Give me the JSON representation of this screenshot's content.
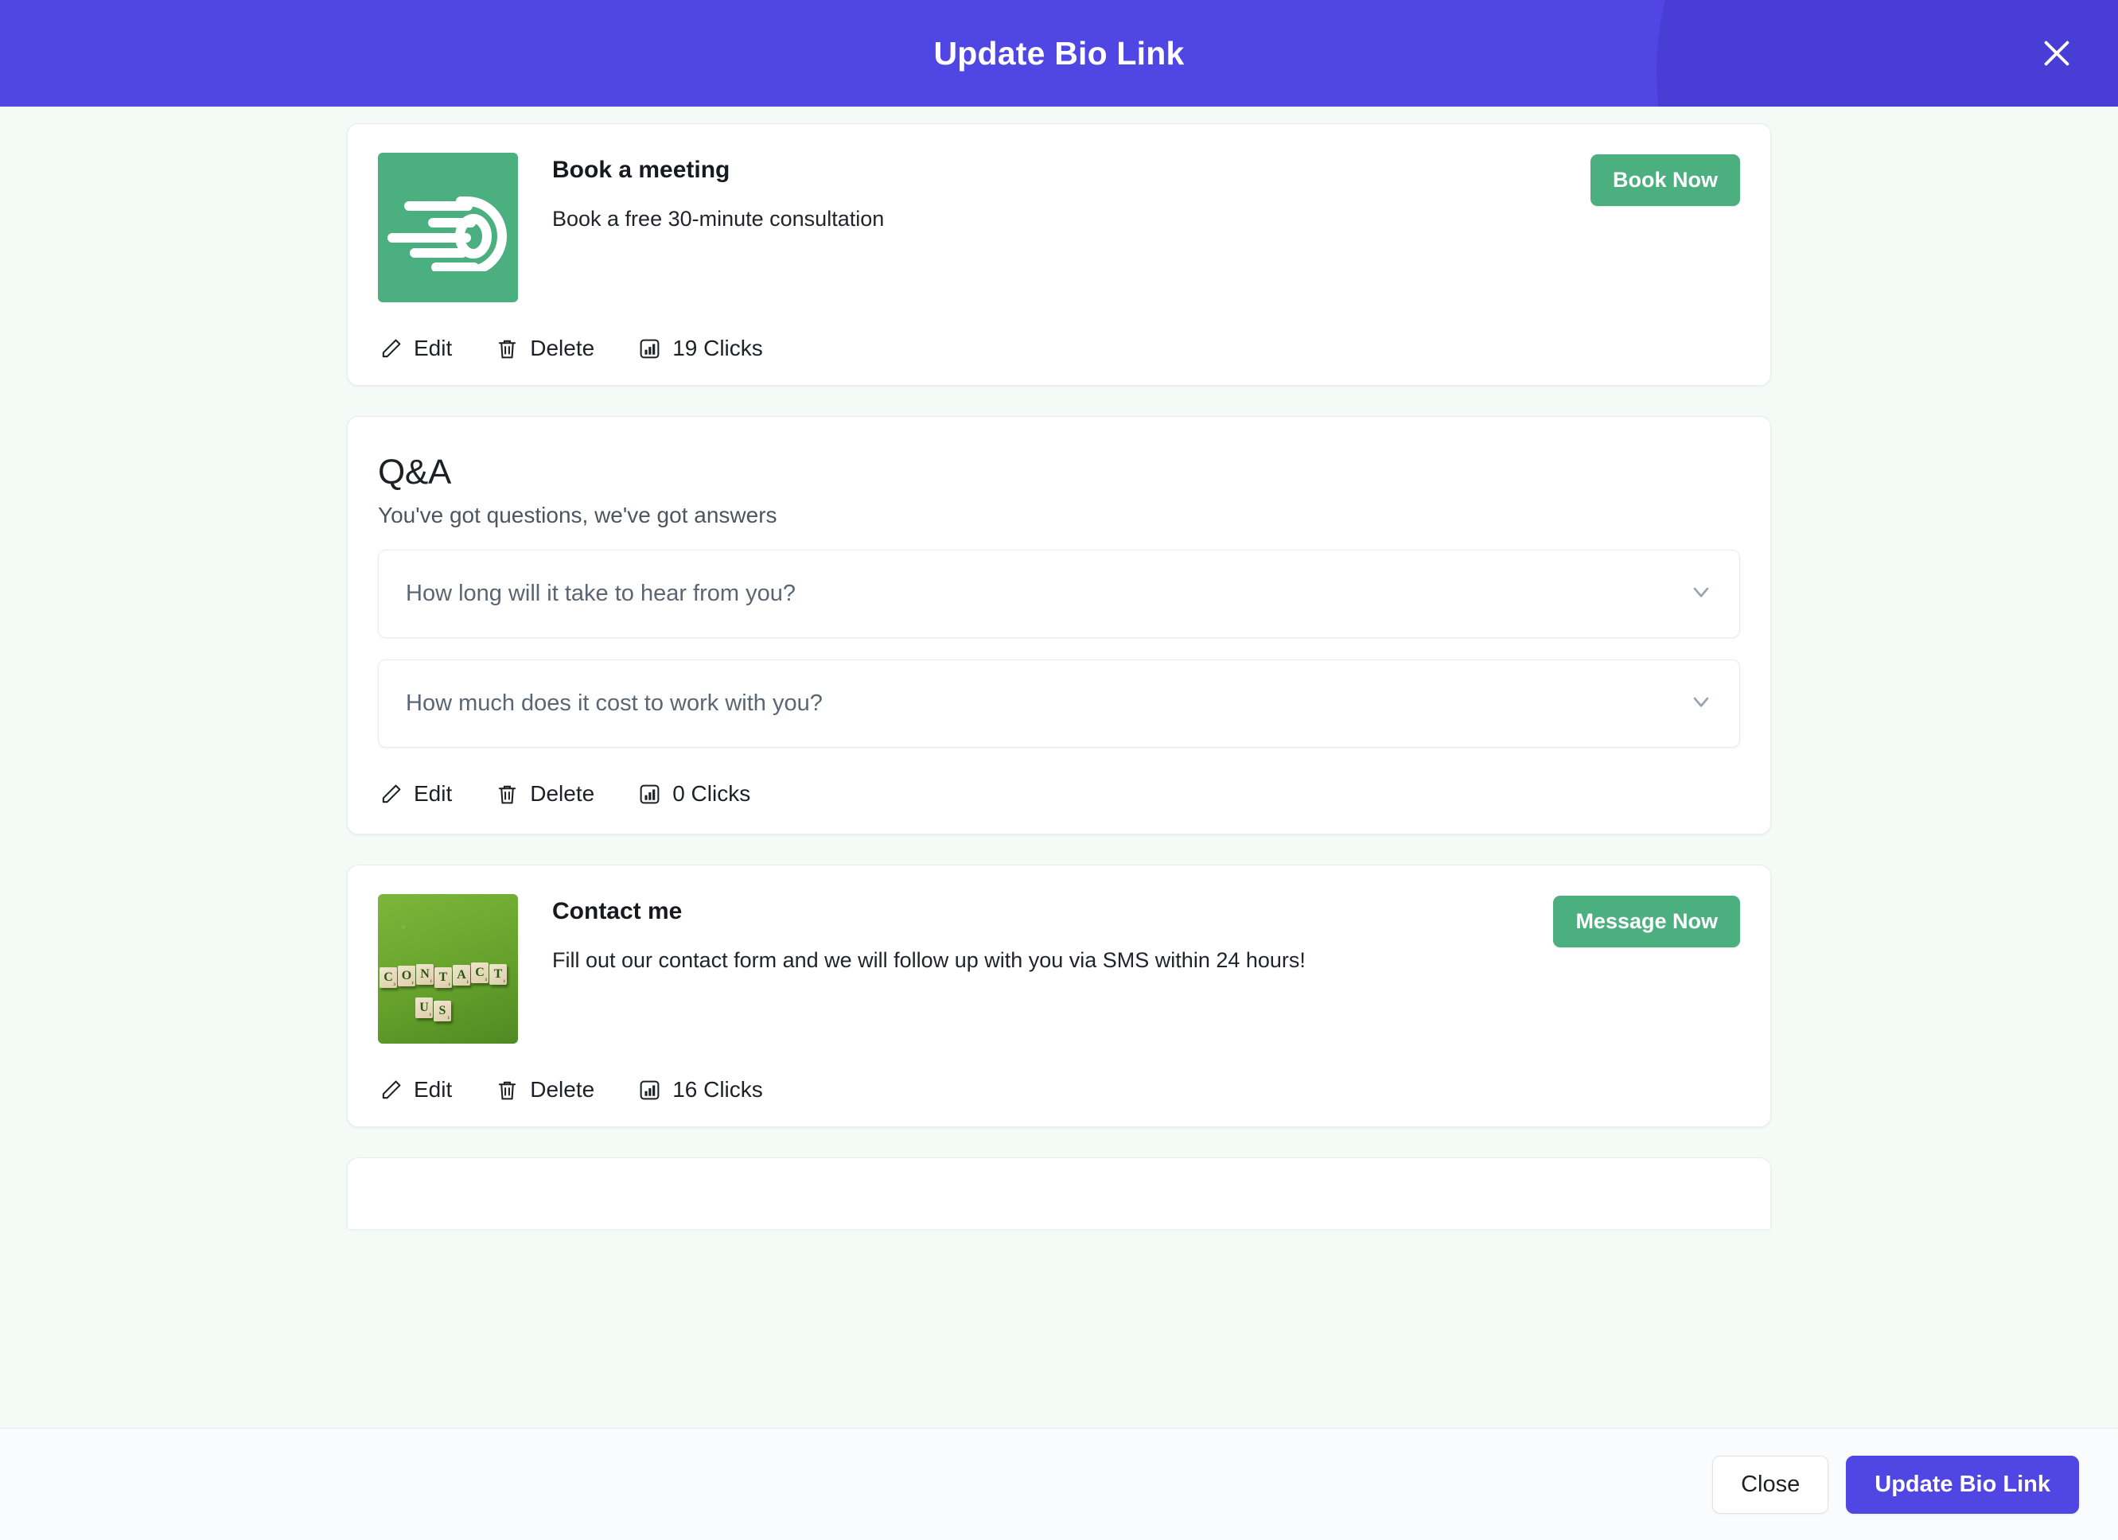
{
  "header": {
    "title": "Update Bio Link",
    "close_icon": "close-icon"
  },
  "colors": {
    "accent_purple": "#5046e4",
    "accent_purple_dark": "#4338ca",
    "green": "#4caf80",
    "body_bg": "#f4faf6",
    "card_bg": "#ffffff",
    "footer_bg": "#fafbfc"
  },
  "action_labels": {
    "edit": "Edit",
    "delete": "Delete"
  },
  "cards": [
    {
      "type": "link",
      "title": "Book a meeting",
      "description": "Book a free 30-minute consultation",
      "cta_label": "Book Now",
      "thumb_kind": "calendly-logo",
      "clicks_label": "19 Clicks",
      "edit_label": "Edit",
      "delete_label": "Delete"
    },
    {
      "type": "qa",
      "title": "Q&A",
      "subtitle": "You've got questions, we've got answers",
      "questions": [
        "How long will it take to hear from you?",
        "How much does it cost to work with you?"
      ],
      "clicks_label": "0 Clicks",
      "edit_label": "Edit",
      "delete_label": "Delete"
    },
    {
      "type": "link",
      "title": "Contact me",
      "description": "Fill out our contact form and we will follow up with you via SMS within 24 hours!",
      "cta_label": "Message Now",
      "thumb_kind": "contact-us-photo",
      "thumb_alt_text": "CONTACT US",
      "clicks_label": "16 Clicks",
      "edit_label": "Edit",
      "delete_label": "Delete"
    }
  ],
  "footer": {
    "close_label": "Close",
    "submit_label": "Update Bio Link"
  }
}
